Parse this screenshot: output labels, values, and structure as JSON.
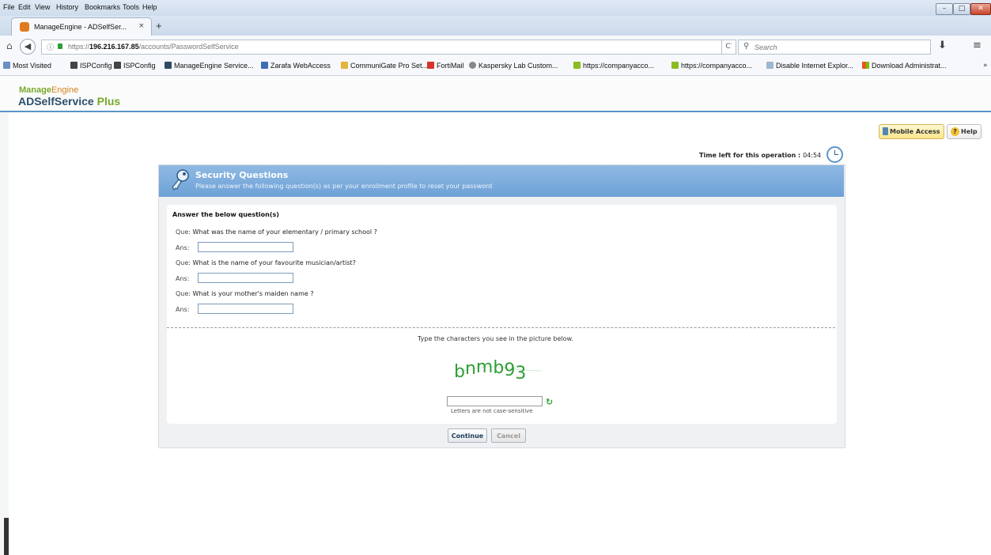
{
  "browser": {
    "menu": [
      "File",
      "Edit",
      "View",
      "History",
      "Bookmarks",
      "Tools",
      "Help"
    ],
    "tab_title": "ManageEngine - ADSelfSer...",
    "tab_close": "×",
    "new_tab": "+",
    "url_prefix": "https://",
    "url_host": "196.216.167.85",
    "url_path": "/accounts/PasswordSelfService",
    "search_placeholder": "Search",
    "bookmarks": [
      "Most Visited",
      "ISPConfig",
      "ISPConfig",
      "ManageEngine Service...",
      "Zarafa WebAccess",
      "CommuniGate Pro Set...",
      "FortiMail",
      "Kaspersky Lab Custom...",
      "https://companyacco...",
      "https://companyacco...",
      "Disable Internet Explor...",
      "Download Administrat..."
    ],
    "bookmarks_more": "»"
  },
  "app": {
    "brand_top_a": "Manage",
    "brand_top_b": "Engine",
    "brand_main_a": "ADSelfService",
    "brand_main_b": " Plus",
    "mobile_access": "Mobile Access",
    "help": "Help"
  },
  "timer": {
    "label": "Time left for this operation :",
    "value": "04:54"
  },
  "panel": {
    "title": "Security Questions",
    "subtitle": "Please answer the following question(s) as per your enrollment profile to reset your password",
    "heading": "Answer the below question(s)",
    "que_label": "Que:",
    "ans_label": "Ans:",
    "questions": [
      "What was the name of your elementary / primary school ?",
      "What is the name of your favourite musician/artist?",
      "What is your mother's maiden name ?"
    ],
    "captcha_instruction": "Type the characters you see in the picture below.",
    "captcha_text": "bnmb93",
    "case_note": "Letters are not case-sensitive",
    "continue_label": "Continue",
    "cancel_label": "Cancel"
  },
  "colors": {
    "header_blue": "#6ea1d7",
    "brand_green": "#78a82a",
    "brand_orange": "#d4821d",
    "captcha_green": "#2e9e36"
  }
}
